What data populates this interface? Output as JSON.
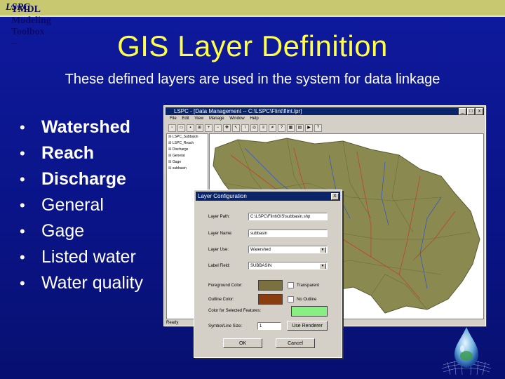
{
  "header": {
    "prefix": "TMDL Modeling Toolbox – ",
    "product": "LSPC"
  },
  "title": "GIS Layer Definition",
  "subtitle": "These defined layers are used in the system for data linkage",
  "bullets": [
    {
      "label": "Watershed",
      "emphasis": true
    },
    {
      "label": "Reach",
      "emphasis": true
    },
    {
      "label": "Discharge",
      "emphasis": true
    },
    {
      "label": "General",
      "emphasis": false
    },
    {
      "label": "Gage",
      "emphasis": false
    },
    {
      "label": "Listed water",
      "emphasis": false
    },
    {
      "label": "Water quality",
      "emphasis": false
    }
  ],
  "app_window": {
    "title": "LSPC - [Data Management -- C:\\LSPC\\Flint\\flint.lpr]",
    "menu": [
      "File",
      "Edit",
      "View",
      "Manage",
      "Window",
      "Help"
    ],
    "layers": [
      "LSPC_Subbasin",
      "LSPC_Reach",
      "Discharge",
      "General",
      "Gage",
      "subbasin"
    ],
    "status": "Ready"
  },
  "dialog": {
    "title": "Layer Configuration",
    "close": "X",
    "layer_path_label": "Layer Path:",
    "layer_path_value": "C:\\LSPC\\Flint\\GIS\\subbasin.shp",
    "layer_name_label": "Layer Name:",
    "layer_name_value": "subbasin",
    "layer_use_label": "Layer Use:",
    "layer_use_value": "Watershed",
    "label_field_label": "Label Field:",
    "label_field_value": "SUBBASIN",
    "fg_color_label": "Foreground Color:",
    "outline_color_label": "Outline Color:",
    "selected_color_label": "Color for Selected Features:",
    "symbol_size_label": "Symbol/Line Size:",
    "symbol_size_value": "1",
    "transparent_label": "Transparent",
    "no_outline_label": "No Outline",
    "use_renderer_label": "Use Renderer",
    "ok_label": "OK",
    "cancel_label": "Cancel",
    "colors": {
      "foreground": "#7a7040",
      "outline": "#8a3e10",
      "selected": "#88f080"
    }
  }
}
